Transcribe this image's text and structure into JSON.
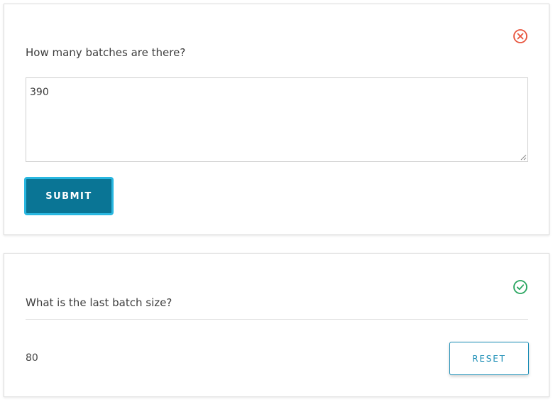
{
  "questions": [
    {
      "prompt": "How many batches are there?",
      "status": "incorrect",
      "status_icon": "x-circle-icon",
      "status_color": "#e8553e",
      "answer": "390",
      "submit_label": "SUBMIT"
    },
    {
      "prompt": "What is the last batch size?",
      "status": "correct",
      "status_icon": "check-circle-icon",
      "status_color": "#28a55f",
      "answer": "80",
      "reset_label": "RESET"
    }
  ],
  "colors": {
    "primary": "#0a7595",
    "focus_ring": "#29b7e0",
    "link": "#1a8db5"
  }
}
